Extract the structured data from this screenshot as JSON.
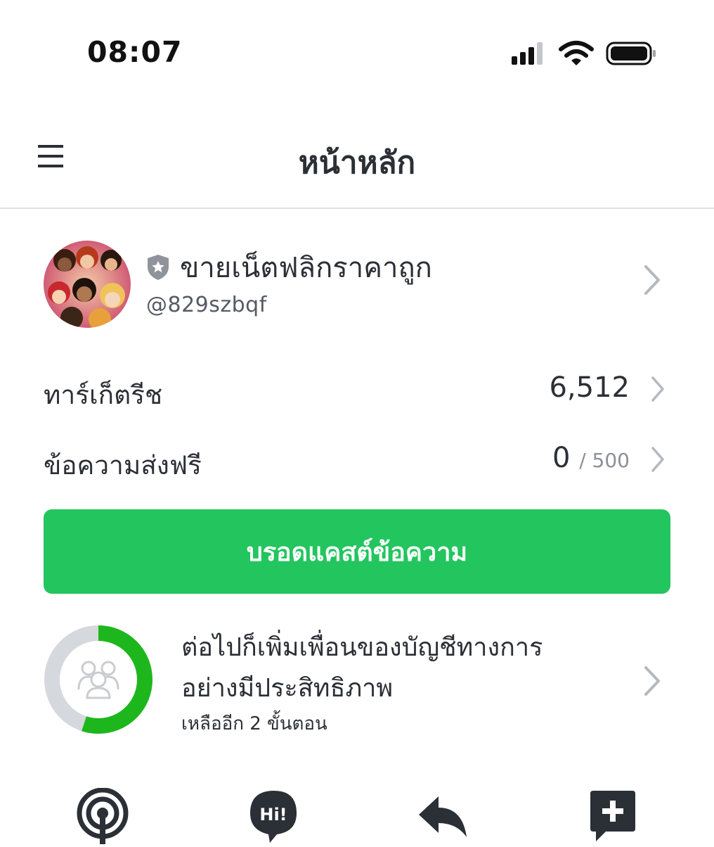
{
  "status_bar": {
    "time": "08:07",
    "icons": [
      "cellular-signal-icon",
      "wifi-icon",
      "battery-icon"
    ]
  },
  "header": {
    "menu_icon": "hamburger-menu-icon",
    "title": "หน้าหลัก"
  },
  "profile": {
    "badge_icon": "verified-shield-icon",
    "name": "ขายเน็ตฟลิกราคาถูก",
    "account_id": "@829szbqf"
  },
  "stats": {
    "target_reach": {
      "label": "ทาร์เก็ตรีช",
      "value": "6,512"
    },
    "free_messages": {
      "label": "ข้อความส่งฟรี",
      "value": "0",
      "quota": "/ 500"
    }
  },
  "broadcast_button": {
    "label": "บรอดแคสต์ข้อความ"
  },
  "progress_card": {
    "line1": "ต่อไปก็เพิ่มเพื่อนของบัญชีทางการ",
    "line2": "อย่างมีประสิทธิภาพ",
    "sub": "เหลืออีก 2 ขั้นตอน",
    "progress_fraction": 0.55,
    "icon": "friends-group-icon"
  },
  "bottom_icons": [
    "broadcast-antenna-icon",
    "greeting-hi-icon",
    "auto-reply-icon",
    "add-post-icon"
  ],
  "colors": {
    "accent_green": "#22c55e",
    "donut_green": "#1db71d",
    "donut_track": "#d5d8dd",
    "text_dark": "#2b2f36",
    "chevron_gray": "#b4b8bf"
  }
}
